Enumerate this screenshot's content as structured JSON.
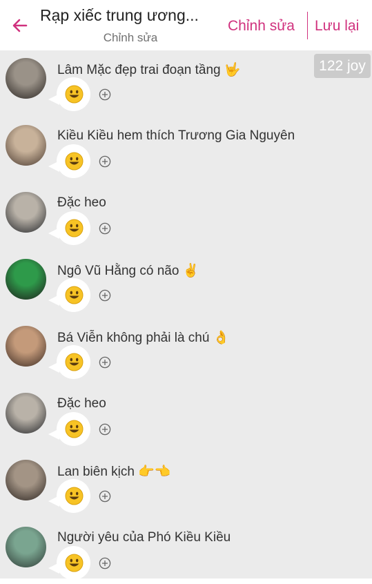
{
  "header": {
    "title": "Rạp xiếc trung ương...",
    "subtitle": "Chỉnh sửa",
    "edit_label": "Chỉnh sửa",
    "save_label": "Lưu lại"
  },
  "badge": "122 joy",
  "members": [
    {
      "name": "Lâm Mặc đẹp trai đoạn tầng 🤟",
      "avatar_colors": [
        "#9a9288",
        "#2a2522"
      ]
    },
    {
      "name": "Kiều Kiều hem thích Trương Gia Nguyên",
      "avatar_colors": [
        "#c8b29a",
        "#4a3a30"
      ]
    },
    {
      "name": "Đặc heo",
      "avatar_colors": [
        "#b9b2a8",
        "#222428"
      ]
    },
    {
      "name": "Ngô Vũ Hằng có não ✌️",
      "avatar_colors": [
        "#2e9a4a",
        "#1f1c1c"
      ]
    },
    {
      "name": "Bá Viễn không phải là chú 👌",
      "avatar_colors": [
        "#c49a7a",
        "#3a2a22"
      ]
    },
    {
      "name": "Đặc heo",
      "avatar_colors": [
        "#b9b2a8",
        "#222428"
      ]
    },
    {
      "name": "Lan biên kịch 👉👈",
      "avatar_colors": [
        "#a39485",
        "#2b2420"
      ]
    },
    {
      "name": "Người yêu của Phó Kiều Kiều",
      "avatar_colors": [
        "#7aa590",
        "#2e3a35"
      ]
    }
  ],
  "colors": {
    "accent": "#d0317e",
    "background": "#ebebeb",
    "badge": "#cbcbcb"
  },
  "icons": {
    "back": "arrow-left-icon",
    "reaction": "smile-emoji-icon",
    "add": "plus-circle-icon"
  }
}
